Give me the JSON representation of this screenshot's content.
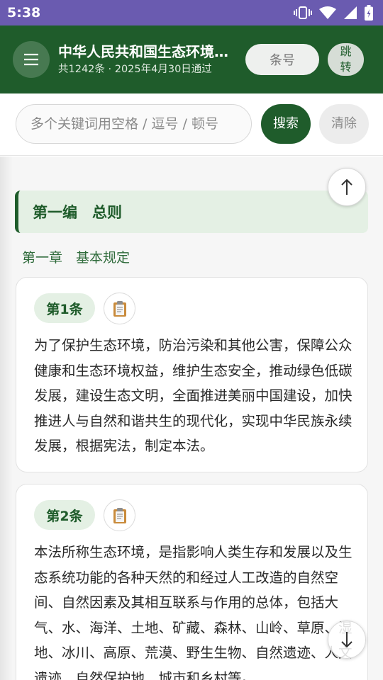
{
  "status_bar": {
    "time": "5:38",
    "icons": [
      "vibrate-icon",
      "wifi-icon",
      "signal-icon",
      "battery-icon"
    ]
  },
  "app_bar": {
    "menu_icon": "menu-icon",
    "title": "中华人民共和国生态环境法典",
    "subtitle": "共1242条 · 2025年4月30日通过",
    "article_no_button": "条号",
    "jump_button": "跳转"
  },
  "search": {
    "placeholder": "多个关键词用空格 / 逗号 / 顿号",
    "value": "",
    "search_button": "搜索",
    "clear_button": "清除"
  },
  "content": {
    "part_heading": "第一编　总则",
    "chapter_heading": "第一章　基本规定",
    "articles": [
      {
        "label": "第1条",
        "text": "为了保护生态环境，防治污染和其他公害，保障公众健康和生态环境权益，维护生态安全，推动绿色低碳发展，建设生态文明，全面推进美丽中国建设，加快推进人与自然和谐共生的现代化，实现中华民族永续发展，根据宪法，制定本法。"
      },
      {
        "label": "第2条",
        "text": "本法所称生态环境，是指影响人类生存和发展以及生态系统功能的各种天然的和经过人工改造的自然空间、自然因素及其相互联系与作用的总体，包括大气、水、海洋、土地、矿藏、森林、山岭、草原、湿地、冰川、高原、荒漠、野生生物、自然遗迹、人文遗迹、自然保护地、城市和乡村等。"
      }
    ]
  },
  "colors": {
    "status_bar": "#6a5bb0",
    "primary": "#1f5c2b",
    "badge_bg": "#e4f0e4"
  }
}
